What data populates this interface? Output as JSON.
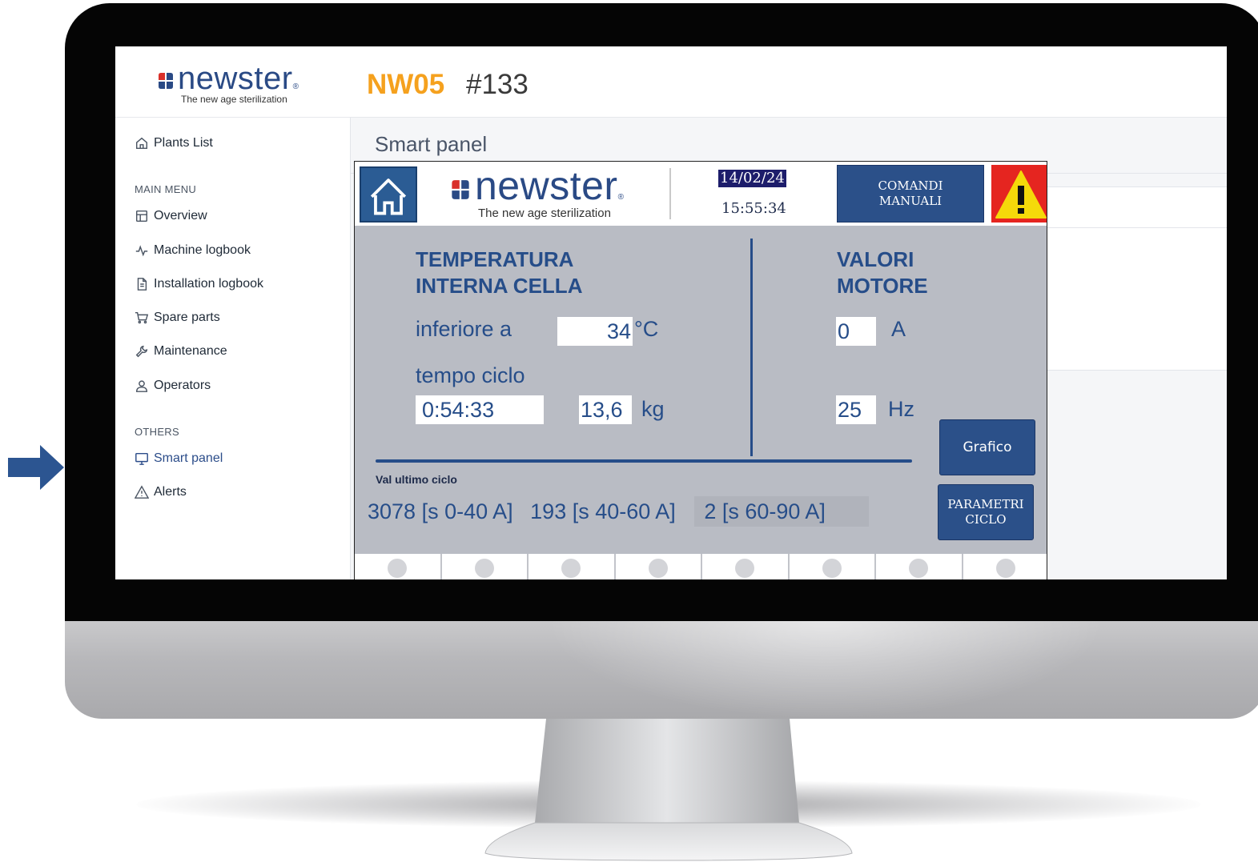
{
  "header": {
    "brand_name": "newster",
    "brand_tagline": "The new age sterilization",
    "model": "NW05",
    "serial": "#133"
  },
  "sidebar": {
    "plants_list": "Plants List",
    "main_menu_label": "MAIN MENU",
    "main_items": [
      {
        "label": "Overview",
        "icon": "layout-icon"
      },
      {
        "label": "Machine logbook",
        "icon": "activity-icon"
      },
      {
        "label": "Installation logbook",
        "icon": "document-icon"
      },
      {
        "label": "Spare parts",
        "icon": "cart-icon"
      },
      {
        "label": "Maintenance",
        "icon": "wrench-icon"
      },
      {
        "label": "Operators",
        "icon": "user-icon"
      }
    ],
    "others_label": "OTHERS",
    "other_items": [
      {
        "label": "Smart panel",
        "icon": "monitor-icon",
        "active": true
      },
      {
        "label": "Alerts",
        "icon": "warning-icon"
      }
    ]
  },
  "main": {
    "page_title": "Smart panel"
  },
  "smart_panel": {
    "brand_name": "newster",
    "brand_tagline": "The new age sterilization",
    "date": "14/02/24",
    "time": "15:55:34",
    "manual_commands_label": "COMANDI MANUALI",
    "temperature_title": "TEMPERATURA INTERNA CELLA",
    "below_label": "inferiore a",
    "temperature_value": "34",
    "temperature_unit": "°C",
    "cycle_time_label": "tempo ciclo",
    "cycle_time_value": "0:54:33",
    "weight_value": "13,6",
    "weight_unit": "kg",
    "motor_title": "VALORI MOTORE",
    "current_value": "0",
    "current_unit": "A",
    "frequency_value": "25",
    "frequency_unit": "Hz",
    "last_cycle_label": "Val ultimo ciclo",
    "last_cycle_stats": [
      "3078 [s 0-40 A]",
      "193 [s 40-60 A]",
      "2 [s 60-90 A]"
    ],
    "chart_button_label": "Grafico",
    "cycle_params_label": "PARAMETRI CICLO",
    "footer_indicator_count": 8
  },
  "colors": {
    "accent_orange": "#f5a11e",
    "brand_blue": "#2a4a85",
    "hmi_button_blue": "#2b5089",
    "alert_red": "#e52520",
    "alert_yellow": "#f5d90a",
    "arrow_blue": "#2c5591"
  }
}
